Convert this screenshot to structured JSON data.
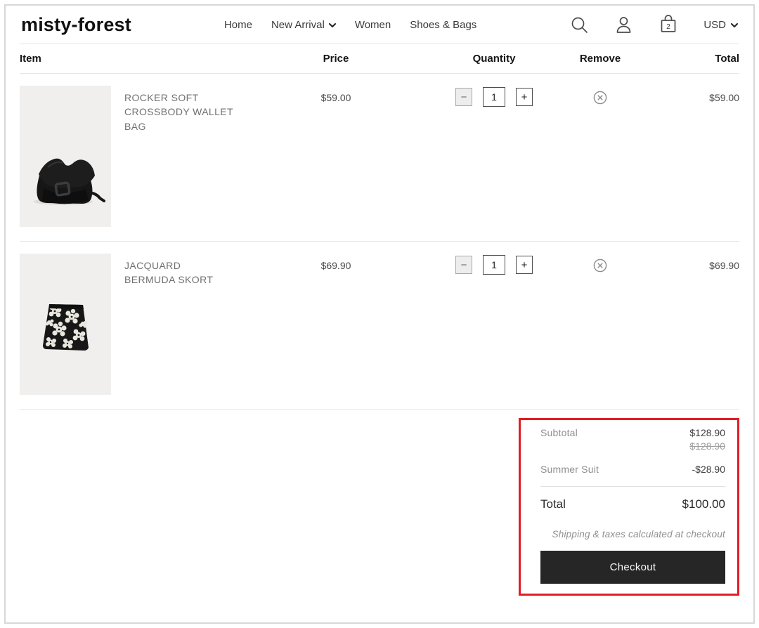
{
  "brand": "misty-forest",
  "nav": {
    "items": {
      "home": "Home",
      "new_arrival": "New Arrival",
      "women": "Women",
      "shoes_bags": "Shoes & Bags"
    }
  },
  "header_icons": {
    "cart_count": "2",
    "currency": "USD"
  },
  "table": {
    "headers": [
      "Item",
      "Price",
      "Quantity",
      "Remove",
      "Total"
    ],
    "quantity_minus": "−",
    "quantity_plus": "+",
    "rows": [
      {
        "title": "ROCKER SOFT CROSSBODY WALLET BAG",
        "image": "black-crossbody-wallet-bag",
        "price": "$59.00",
        "quantity": "1",
        "total": "$59.00"
      },
      {
        "title": "JACQUARD BERMUDA SKORT",
        "image": "black-white-floral-skort",
        "price": "$69.90",
        "quantity": "1",
        "total": "$69.90"
      }
    ]
  },
  "summary": {
    "subtotal_label": "Subtotal",
    "subtotal_value": "$128.90",
    "subtotal_original": "$128.90",
    "discount_label": "Summer Suit",
    "discount_value": "-$28.90",
    "total_label": "Total",
    "total_value": "$100.00",
    "note": "Shipping & taxes calculated at checkout",
    "checkout_label": "Checkout"
  },
  "colors": {
    "highlight_border": "#e01e24",
    "checkout_background": "#262626",
    "product_image_background": "#f0efed"
  }
}
